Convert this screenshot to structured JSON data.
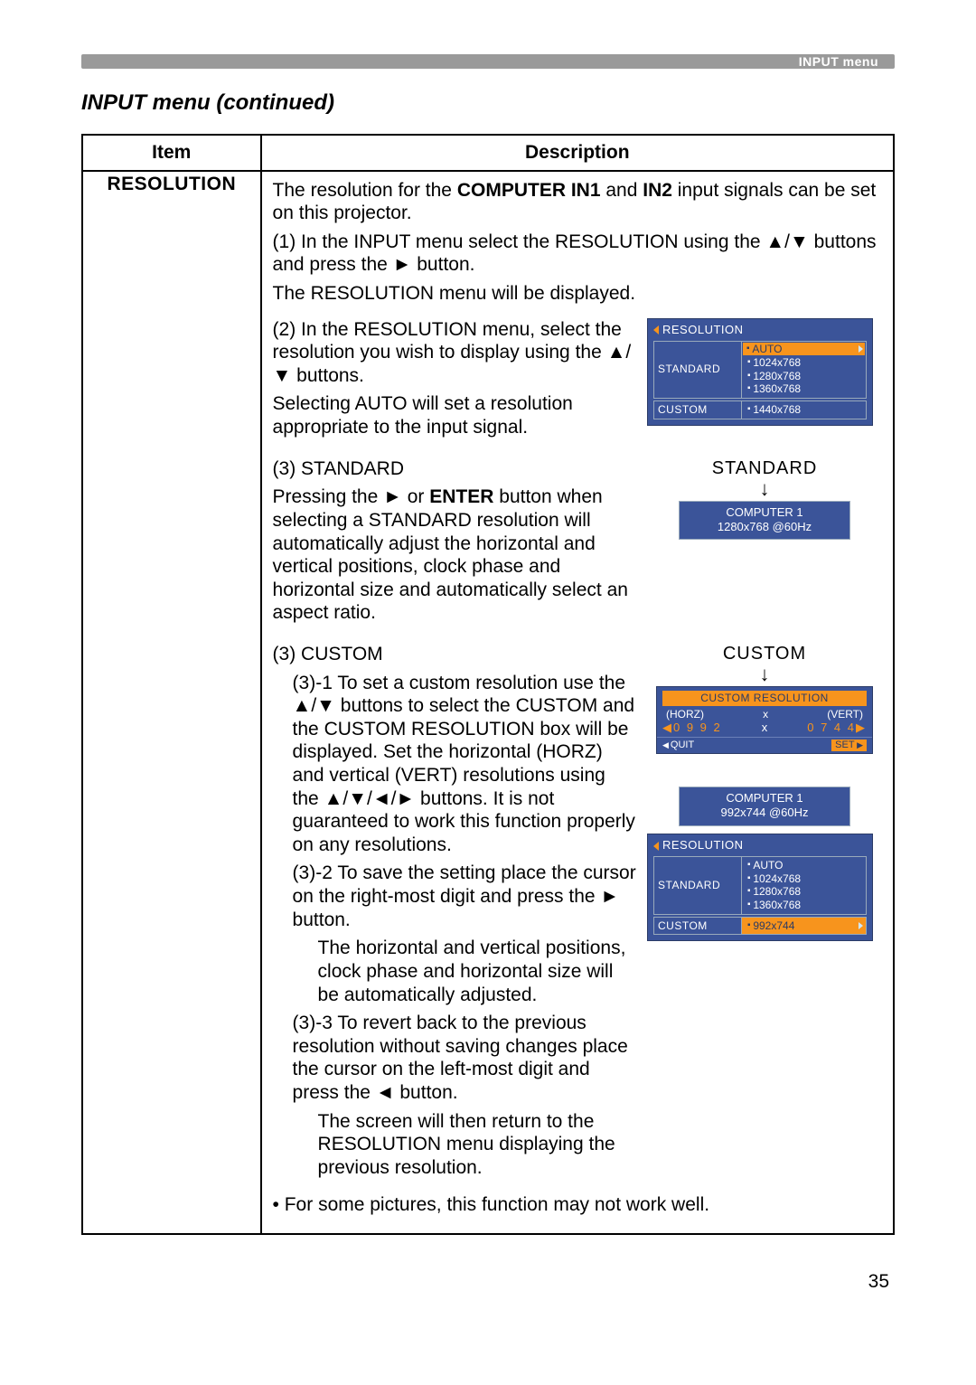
{
  "header": {
    "label": "INPUT menu"
  },
  "section_title": "INPUT menu (continued)",
  "table": {
    "headers": {
      "item": "Item",
      "description": "Description"
    },
    "item_label": "RESOLUTION",
    "intro": [
      "The resolution for the COMPUTER IN1 and IN2 input signals can be set on this projector.",
      "(1) In the INPUT menu select the RESOLUTION using the ▲/▼ buttons and press the ► button.",
      "The RESOLUTION menu will be displayed."
    ],
    "step2_text": [
      "(2) In the RESOLUTION menu, select the resolution you wish to display using the ▲/▼ buttons.",
      "Selecting AUTO will set a resolution appropriate to the input signal."
    ],
    "step3_text": [
      "(3) STANDARD",
      "Pressing the ► or ENTER button when selecting a STANDARD resolution will automatically adjust the horizontal and vertical positions, clock phase and horizontal size and automatically select an aspect ratio."
    ],
    "custom_text": [
      "(3) CUSTOM",
      "(3)-1 To set a custom resolution use the ▲/▼ buttons to select the CUSTOM and the CUSTOM RESOLUTION box will be displayed. Set the horizontal (HORZ) and vertical (VERT) resolutions using the ▲/▼/◄/► buttons. It is not guaranteed to work this function properly on any resolutions.",
      "(3)-2 To save the setting place the cursor on the right-most digit and press the ► button.",
      "The horizontal and vertical positions, clock phase and horizontal size will be automatically adjusted.",
      "(3)-3 To revert back to the previous resolution without saving changes place the cursor on the left-most digit and press the ◄ button.",
      "The screen will then return to the RESOLUTION menu displaying the previous resolution."
    ],
    "note": "• For some pictures, this function may not work well."
  },
  "osd": {
    "resolution_title": "RESOLUTION",
    "standard_label": "STANDARD",
    "custom_label": "CUSTOM",
    "auto_label": "AUTO",
    "std_options": [
      "1024x768",
      "1280x768",
      "1360x768"
    ],
    "custom_value_1": "1440x768",
    "custom_value_2": "992x744",
    "standard_panel": {
      "title": "STANDARD",
      "source": "COMPUTER 1",
      "mode": "1280x768 @60Hz"
    },
    "custom_panel_title": "CUSTOM",
    "custom_res_title": "CUSTOM RESOLUTION",
    "horz_label": "(HORZ)",
    "vert_label": "(VERT)",
    "mid_x": "x",
    "horz_val": "0 9 9 2",
    "vert_val": "0 7 4 4",
    "quit": "QUIT",
    "set": "SET",
    "result_panel": {
      "source": "COMPUTER 1",
      "mode": "992x744 @60Hz"
    }
  },
  "page_number": "35"
}
